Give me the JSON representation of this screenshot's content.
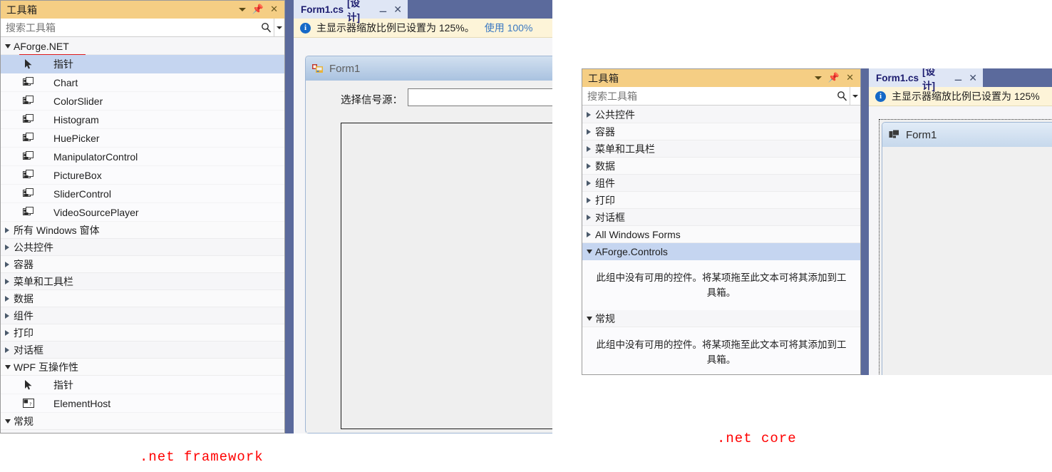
{
  "left_toolbox": {
    "title": "工具箱",
    "search_placeholder": "搜索工具箱",
    "header_icons": {
      "dropdown": "chevron-down-icon",
      "pin": "pin-icon",
      "close": "close-icon"
    },
    "groups": [
      {
        "label": "AForge.NET",
        "expanded": true,
        "selected": false,
        "underlined": true,
        "items": [
          {
            "label": "指针",
            "icon": "pointer-icon",
            "selected": true
          },
          {
            "label": "Chart",
            "icon": "control-icon",
            "selected": false
          },
          {
            "label": "ColorSlider",
            "icon": "control-icon",
            "selected": false
          },
          {
            "label": "Histogram",
            "icon": "control-icon",
            "selected": false
          },
          {
            "label": "HuePicker",
            "icon": "control-icon",
            "selected": false
          },
          {
            "label": "ManipulatorControl",
            "icon": "control-icon",
            "selected": false
          },
          {
            "label": "PictureBox",
            "icon": "control-icon",
            "selected": false
          },
          {
            "label": "SliderControl",
            "icon": "control-icon",
            "selected": false
          },
          {
            "label": "VideoSourcePlayer",
            "icon": "control-icon",
            "selected": false
          }
        ]
      },
      {
        "label": "所有 Windows 窗体",
        "expanded": false,
        "items": []
      },
      {
        "label": "公共控件",
        "expanded": false,
        "items": []
      },
      {
        "label": "容器",
        "expanded": false,
        "items": []
      },
      {
        "label": "菜单和工具栏",
        "expanded": false,
        "items": []
      },
      {
        "label": "数据",
        "expanded": false,
        "items": []
      },
      {
        "label": "组件",
        "expanded": false,
        "items": []
      },
      {
        "label": "打印",
        "expanded": false,
        "items": []
      },
      {
        "label": "对话框",
        "expanded": false,
        "items": []
      },
      {
        "label": "WPF 互操作性",
        "expanded": true,
        "items": [
          {
            "label": "指针",
            "icon": "pointer-icon",
            "selected": false
          },
          {
            "label": "ElementHost",
            "icon": "elementhost-icon",
            "selected": false
          }
        ]
      },
      {
        "label": "常规",
        "expanded": true,
        "items": []
      }
    ]
  },
  "center_designer": {
    "tab": {
      "name": "Form1.cs",
      "suffix": "[设计]",
      "pin": "pin-icon",
      "close": "close-icon"
    },
    "infobar": {
      "icon": "info-icon",
      "message": "主显示器缩放比例已设置为 125%。",
      "link": "使用 100%"
    },
    "form": {
      "title": "Form1",
      "icon": "winform-icon",
      "label": "选择信号源：",
      "combo_value": ""
    }
  },
  "right_toolbox": {
    "title": "工具箱",
    "search_placeholder": "搜索工具箱",
    "header_icons": {
      "dropdown": "chevron-down-icon",
      "pin": "pin-icon",
      "close": "close-icon"
    },
    "groups": [
      {
        "label": "公共控件",
        "expanded": false
      },
      {
        "label": "容器",
        "expanded": false
      },
      {
        "label": "菜单和工具栏",
        "expanded": false
      },
      {
        "label": "数据",
        "expanded": false
      },
      {
        "label": "组件",
        "expanded": false
      },
      {
        "label": "打印",
        "expanded": false
      },
      {
        "label": "对话框",
        "expanded": false
      },
      {
        "label": "All Windows Forms",
        "expanded": false
      },
      {
        "label": "AForge.Controls",
        "expanded": true,
        "selected": true
      },
      {
        "label": "常规",
        "expanded": true,
        "selected": false
      }
    ],
    "empty_group_message": "此组中没有可用的控件。将某项拖至此文本可将其添加到工具箱。"
  },
  "right_designer": {
    "tab": {
      "name": "Form1.cs",
      "suffix": "[设计]",
      "pin": "pin-icon",
      "close": "close-icon"
    },
    "infobar": {
      "icon": "info-icon",
      "message": "主显示器缩放比例已设置为 125%"
    },
    "form": {
      "title": "Form1",
      "icon": "winform-icon"
    }
  },
  "annotations": [
    {
      "text": ".net framework",
      "color": "#ff0000"
    },
    {
      "text": ".net core",
      "color": "#ff0000"
    }
  ],
  "colors": {
    "toolbox_header": "#f5ce84",
    "selection": "#c5d5f0",
    "splitter": "#5b6a9c",
    "tab_active": "#dfe6f5",
    "infobar": "#fdf4d8",
    "annotation_red": "#ff0000"
  }
}
